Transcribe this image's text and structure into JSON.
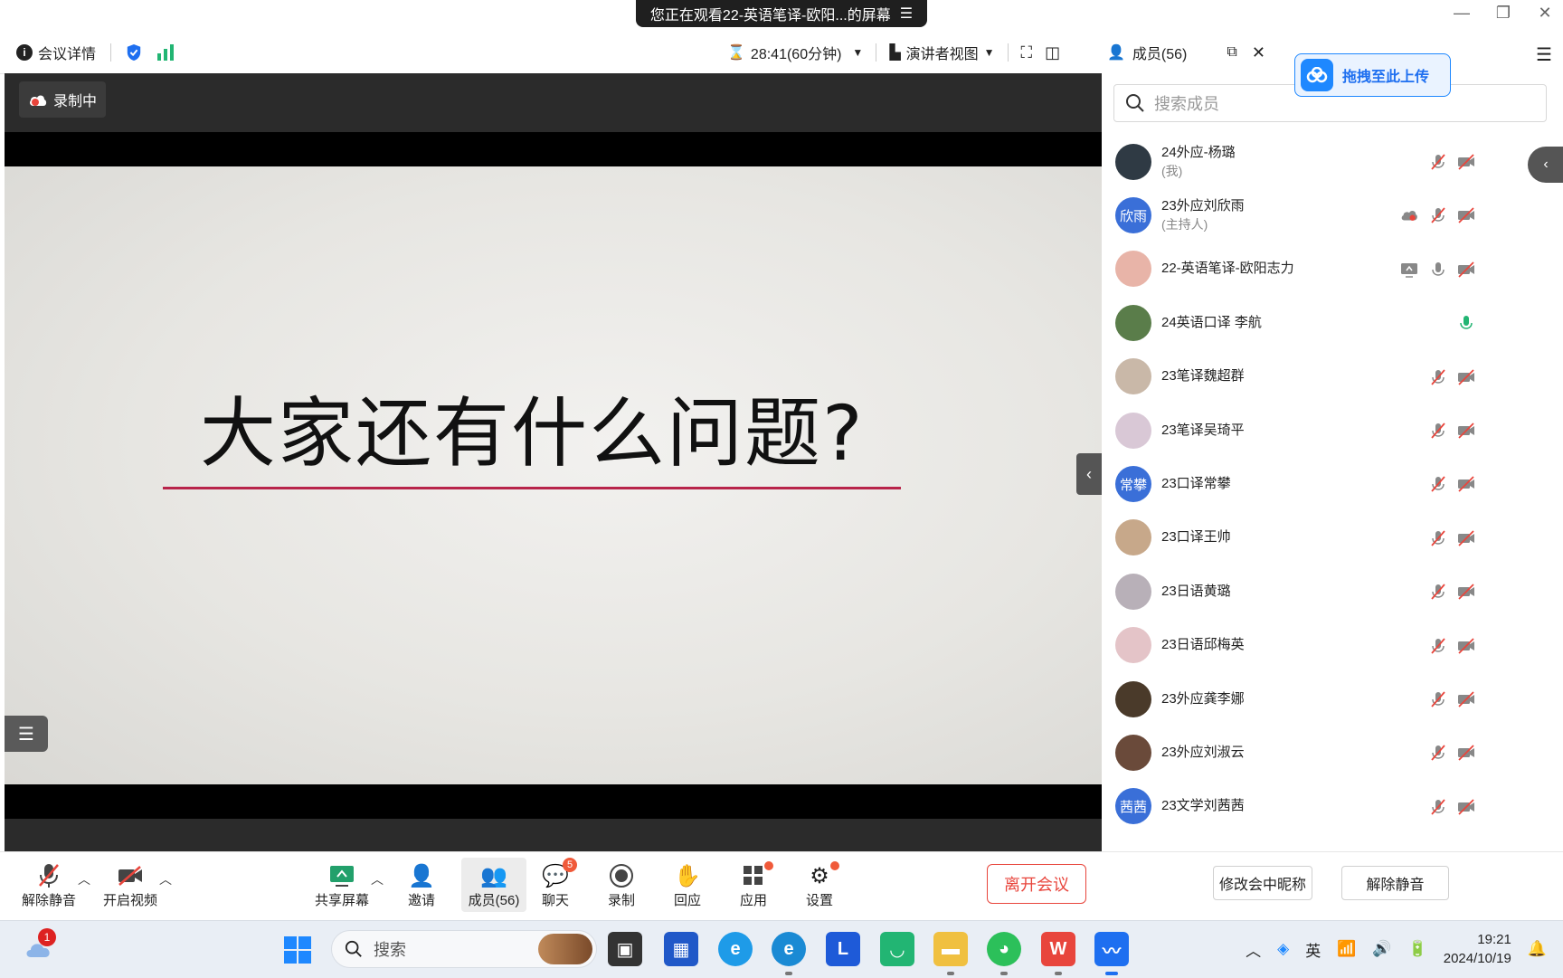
{
  "banner": {
    "text": "您正在观看22-英语笔译-欧阳...的屏幕"
  },
  "toolbar": {
    "meeting_details": "会议详情",
    "timer": "28:41(60分钟)",
    "view_mode": "演讲者视图",
    "members": "成员(56)"
  },
  "video": {
    "recording_label": "录制中",
    "slide_title": "大家还有什么问题?"
  },
  "upload_tip": "拖拽至此上传",
  "search": {
    "placeholder": "搜索成员"
  },
  "members": [
    {
      "name": "24外应-杨璐",
      "sub": "(我)",
      "avatar_color": "#2f3a44",
      "avatar_text": "",
      "status": "mic-off,cam-off"
    },
    {
      "name": "23外应刘欣雨",
      "sub": "(主持人)",
      "avatar_color": "#3a6fd8",
      "avatar_text": "欣雨",
      "status": "recording,mic-off,cam-off"
    },
    {
      "name": "22-英语笔译-欧阳志力",
      "sub": "",
      "avatar_color": "#e8b4a8",
      "avatar_text": "",
      "status": "sharing,mic-on,cam-off"
    },
    {
      "name": "24英语口译 李航",
      "sub": "",
      "avatar_color": "#5a7d4a",
      "avatar_text": "",
      "status": "mic-active"
    },
    {
      "name": "23笔译魏超群",
      "sub": "",
      "avatar_color": "#c9b8a8",
      "avatar_text": "",
      "status": "mic-off,cam-off"
    },
    {
      "name": "23笔译吴琦平",
      "sub": "",
      "avatar_color": "#d9c8d6",
      "avatar_text": "",
      "status": "mic-off,cam-off"
    },
    {
      "name": "23口译常攀",
      "sub": "",
      "avatar_color": "#3a6fd8",
      "avatar_text": "常攀",
      "status": "mic-off,cam-off"
    },
    {
      "name": "23口译王帅",
      "sub": "",
      "avatar_color": "#c7a88a",
      "avatar_text": "",
      "status": "mic-off,cam-off"
    },
    {
      "name": "23日语黄璐",
      "sub": "",
      "avatar_color": "#b8b0b8",
      "avatar_text": "",
      "status": "mic-off,cam-off"
    },
    {
      "name": "23日语邱梅英",
      "sub": "",
      "avatar_color": "#e4c4c8",
      "avatar_text": "",
      "status": "mic-off,cam-off"
    },
    {
      "name": "23外应龚李娜",
      "sub": "",
      "avatar_color": "#4a3a2a",
      "avatar_text": "",
      "status": "mic-off,cam-off"
    },
    {
      "name": "23外应刘淑云",
      "sub": "",
      "avatar_color": "#6a4a3a",
      "avatar_text": "",
      "status": "mic-off,cam-off"
    },
    {
      "name": "23文学刘茜茜",
      "sub": "",
      "avatar_color": "#3a6fd8",
      "avatar_text": "茜茜",
      "status": "mic-off,cam-off"
    }
  ],
  "panel_buttons": {
    "rename": "修改会中昵称",
    "unmute": "解除静音"
  },
  "bottombar": {
    "unmute": "解除静音",
    "start_video": "开启视频",
    "share_screen": "共享屏幕",
    "invite": "邀请",
    "members": "成员(56)",
    "chat": "聊天",
    "chat_badge": "5",
    "record": "录制",
    "react": "回应",
    "apps": "应用",
    "settings": "设置",
    "leave": "离开会议"
  },
  "taskbar": {
    "search": "搜索",
    "weather_badge": "1",
    "ime": "英",
    "time": "19:21",
    "date": "2024/10/19"
  },
  "colors": {
    "accent": "#1e88ff",
    "leave": "#e8453c",
    "slide_line": "#b8244a",
    "mic_active": "#22b573"
  }
}
